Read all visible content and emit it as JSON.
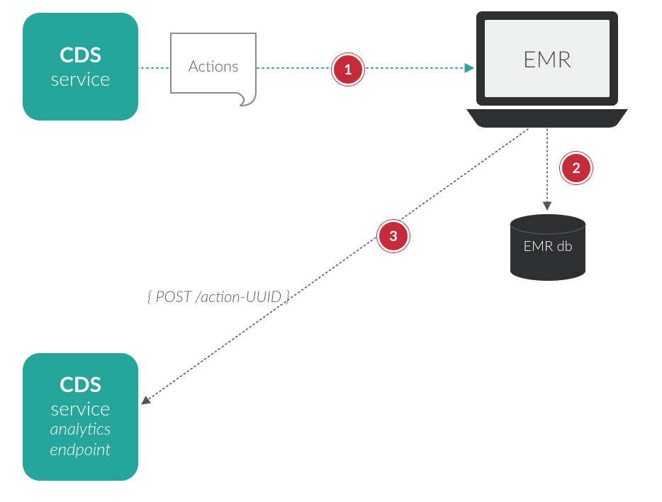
{
  "cds_top": {
    "title": "CDS",
    "subtitle": "service"
  },
  "cds_bottom": {
    "title": "CDS",
    "subtitle": "service",
    "em1": "analytics",
    "em2": "endpoint"
  },
  "actions_label": "Actions",
  "emr_label": "EMR",
  "db_label": "EMR db",
  "post_text": "{ POST /action-UUID }",
  "badges": {
    "b1": "1",
    "b2": "2",
    "b3": "3"
  },
  "colors": {
    "teal": "#26a69a",
    "badge_red": "#c62b39",
    "dark": "#2d2f31",
    "gray_stroke": "#888b8e"
  }
}
